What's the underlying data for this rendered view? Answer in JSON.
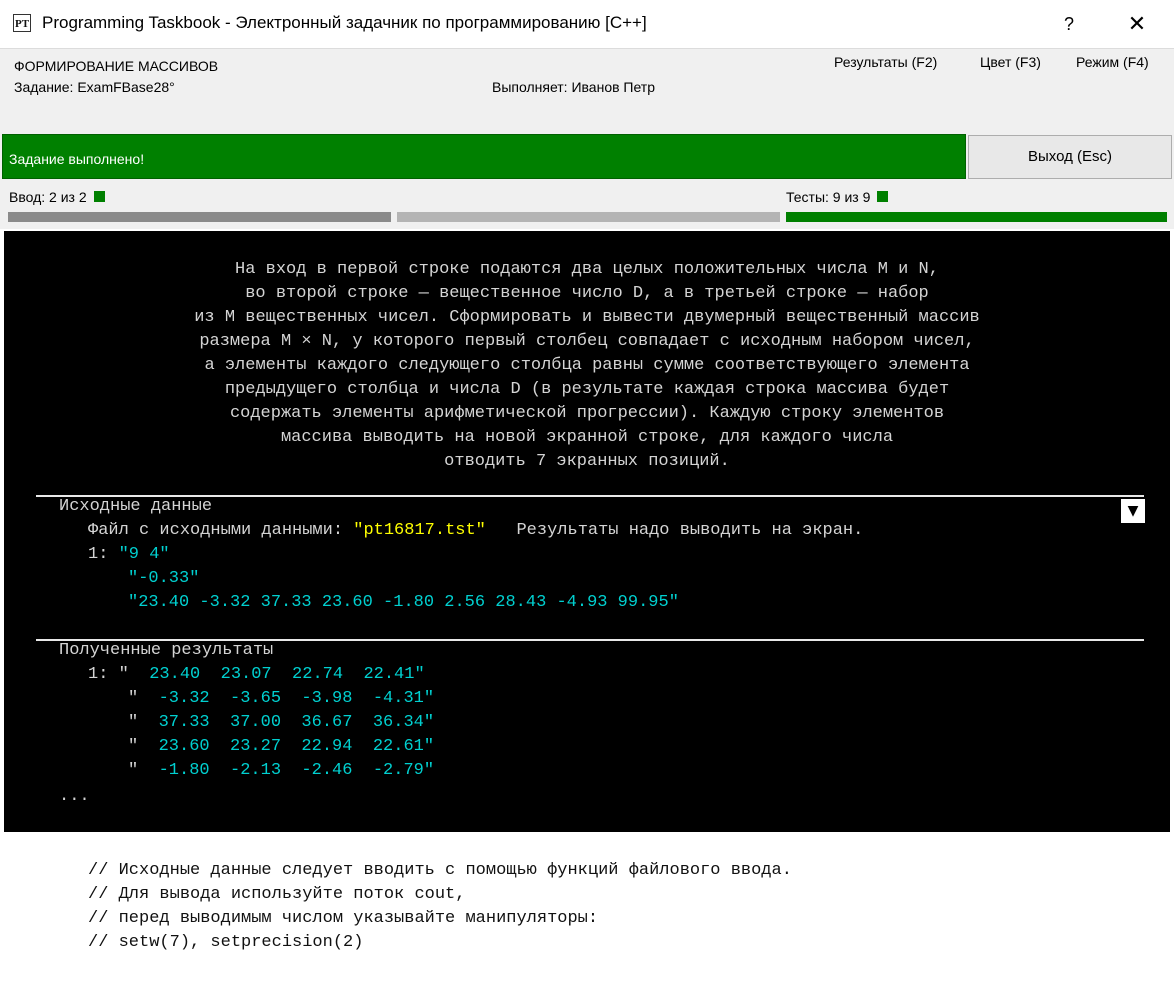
{
  "window": {
    "title": "Programming Taskbook - Электронный задачник по программированию [C++]",
    "icon_text": "PT",
    "help_label": "?",
    "close_label": "✕"
  },
  "header": {
    "group": "ФОРМИРОВАНИЕ МАССИВОВ",
    "task": "Задание: ExamFBase28°",
    "performer": "Выполняет: Иванов Петр",
    "menu": {
      "results": "Результаты (F2)",
      "color": "Цвет (F3)",
      "mode": "Режим (F4)"
    }
  },
  "status": {
    "message": "Задание выполнено!",
    "exit_label": "Выход (Esc)",
    "input_progress": "Ввод:  2 из 2",
    "tests_progress": "Тесты:  9 из 9",
    "colors": {
      "success": "#008000",
      "bar_gray": "#8a8a8a",
      "bar_light": "#b4b4b4"
    }
  },
  "console": {
    "description": [
      "На вход в первой строке подаются два целых положительных числа M и N,",
      "во второй строке — вещественное число D, а в третьей строке — набор",
      "из M вещественных чисел. Сформировать и вывести двумерный вещественный массив",
      "размера M × N, у которого первый столбец совпадает с исходным набором чисел,",
      "а элементы каждого следующего столбца равны сумме соответствующего элемента",
      "предыдущего столбца и числа D (в результате каждая строка массива будет",
      "содержать элементы арифметической прогрессии). Каждую строку элементов",
      "массива выводить на новой экранной строке, для каждого числа",
      "отводить 7 экранных позиций."
    ],
    "input": {
      "title": "Исходные данные",
      "file_label": "Файл с исходными данными: ",
      "file_name": "\"pt16817.tst\"",
      "output_note": "   Результаты надо выводить на экран.",
      "line_prefix": "1: ",
      "lines": [
        "\"9 4\"",
        "\"-0.33\"",
        "\"23.40 -3.32 37.33 23.60 -1.80 2.56 28.43 -4.93 99.95\""
      ]
    },
    "results": {
      "title": "Полученные результаты",
      "line_prefix": "1: ",
      "quote": "\"",
      "lines": [
        "  23.40  23.07  22.74  22.41\"",
        "  -3.32  -3.65  -3.98  -4.31\"",
        "  37.33  37.00  36.67  36.34\"",
        "  23.60  23.27  22.94  22.61\"",
        "  -1.80  -2.13  -2.46  -2.79\""
      ],
      "ellipsis": "..."
    },
    "dropdown_icon": "▼",
    "colors": {
      "text": "#d4d4d4",
      "data": "#00d0d0",
      "file": "#ffff00"
    }
  },
  "comments": [
    "// Исходные данные следует вводить с помощью функций файлового ввода.",
    "// Для вывода используйте поток cout,",
    "// перед выводимым числом указывайте манипуляторы:",
    "// setw(7), setprecision(2)"
  ]
}
